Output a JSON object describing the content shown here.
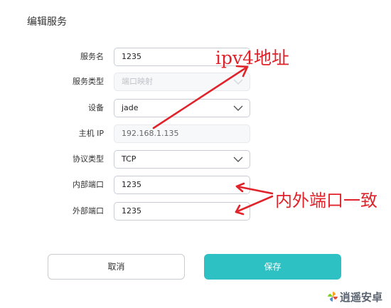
{
  "dialog": {
    "title": "编辑服务"
  },
  "form": {
    "service_name": {
      "label": "服务名",
      "value": "1235"
    },
    "service_type": {
      "label": "服务类型",
      "value": "端口映射",
      "disabled": true
    },
    "device": {
      "label": "设备",
      "value": "jade"
    },
    "host_ip": {
      "label": "主机 IP",
      "value": "192.168.1.135"
    },
    "protocol": {
      "label": "协议类型",
      "value": "TCP"
    },
    "internal_port": {
      "label": "内部端口",
      "value": "1235"
    },
    "external_port": {
      "label": "外部端口",
      "value": "1235"
    }
  },
  "buttons": {
    "cancel": "取消",
    "save": "保存"
  },
  "annotations": {
    "ip_note": "ipv4地址",
    "port_note": "内外端口一致"
  },
  "watermark": {
    "text": "逍遥安卓"
  },
  "colors": {
    "primary": "#2ec1c4",
    "annotation": "#e0232b",
    "border": "#c9cdd3"
  }
}
